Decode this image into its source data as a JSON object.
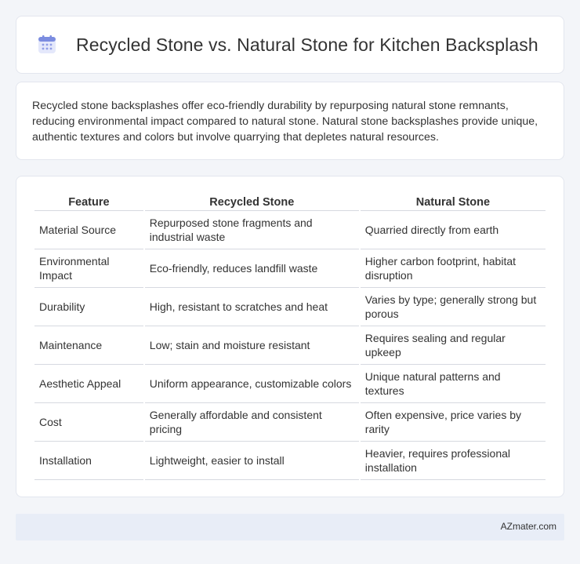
{
  "header": {
    "title": "Recycled Stone vs. Natural Stone for Kitchen Backsplash",
    "icon": "calendar-icon",
    "icon_color": "#6b7bd6"
  },
  "summary": {
    "text": "Recycled stone backsplashes offer eco-friendly durability by repurposing natural stone remnants, reducing environmental impact compared to natural stone. Natural stone backsplashes provide unique, authentic textures and colors but involve quarrying that depletes natural resources."
  },
  "table": {
    "headers": [
      "Feature",
      "Recycled Stone",
      "Natural Stone"
    ],
    "rows": [
      [
        "Material Source",
        "Repurposed stone fragments and industrial waste",
        "Quarried directly from earth"
      ],
      [
        "Environmental Impact",
        "Eco-friendly, reduces landfill waste",
        "Higher carbon footprint, habitat disruption"
      ],
      [
        "Durability",
        "High, resistant to scratches and heat",
        "Varies by type; generally strong but porous"
      ],
      [
        "Maintenance",
        "Low; stain and moisture resistant",
        "Requires sealing and regular upkeep"
      ],
      [
        "Aesthetic Appeal",
        "Uniform appearance, customizable colors",
        "Unique natural patterns and textures"
      ],
      [
        "Cost",
        "Generally affordable and consistent pricing",
        "Often expensive, price varies by rarity"
      ],
      [
        "Installation",
        "Lightweight, easier to install",
        "Heavier, requires professional installation"
      ]
    ]
  },
  "footer": {
    "text": "AZmater.com"
  }
}
